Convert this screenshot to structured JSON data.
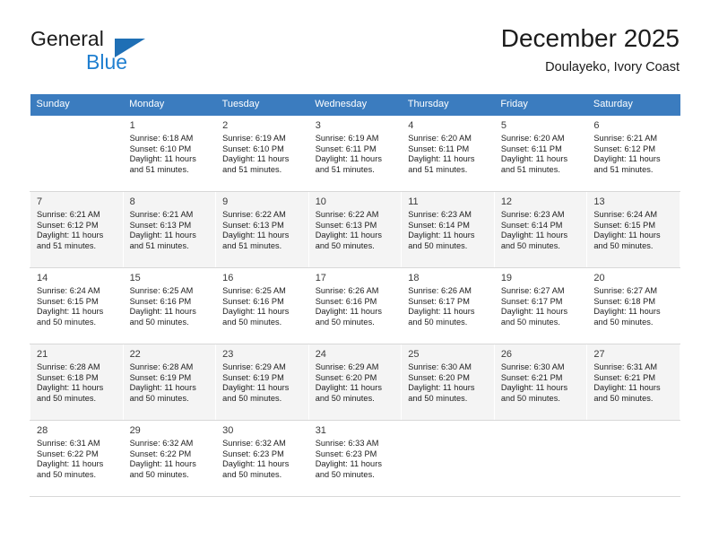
{
  "brand": {
    "name_top": "General",
    "name_bottom": "Blue",
    "triangle_color": "#1f6fb5",
    "blue_color": "#1f7fd0"
  },
  "header": {
    "title": "December 2025",
    "subtitle": "Doulayeko, Ivory Coast"
  },
  "theme": {
    "header_row_bg": "#3b7cbf",
    "header_row_text": "#ffffff",
    "alt_row_bg": "#f4f4f4",
    "cell_border": "#d8d8d8"
  },
  "weekdays": [
    "Sunday",
    "Monday",
    "Tuesday",
    "Wednesday",
    "Thursday",
    "Friday",
    "Saturday"
  ],
  "weeks": [
    {
      "shaded": false,
      "days": [
        {
          "empty": true
        },
        {
          "day": "1",
          "sunrise": "Sunrise: 6:18 AM",
          "sunset": "Sunset: 6:10 PM",
          "daylight_1": "Daylight: 11 hours",
          "daylight_2": "and 51 minutes."
        },
        {
          "day": "2",
          "sunrise": "Sunrise: 6:19 AM",
          "sunset": "Sunset: 6:10 PM",
          "daylight_1": "Daylight: 11 hours",
          "daylight_2": "and 51 minutes."
        },
        {
          "day": "3",
          "sunrise": "Sunrise: 6:19 AM",
          "sunset": "Sunset: 6:11 PM",
          "daylight_1": "Daylight: 11 hours",
          "daylight_2": "and 51 minutes."
        },
        {
          "day": "4",
          "sunrise": "Sunrise: 6:20 AM",
          "sunset": "Sunset: 6:11 PM",
          "daylight_1": "Daylight: 11 hours",
          "daylight_2": "and 51 minutes."
        },
        {
          "day": "5",
          "sunrise": "Sunrise: 6:20 AM",
          "sunset": "Sunset: 6:11 PM",
          "daylight_1": "Daylight: 11 hours",
          "daylight_2": "and 51 minutes."
        },
        {
          "day": "6",
          "sunrise": "Sunrise: 6:21 AM",
          "sunset": "Sunset: 6:12 PM",
          "daylight_1": "Daylight: 11 hours",
          "daylight_2": "and 51 minutes."
        }
      ]
    },
    {
      "shaded": true,
      "days": [
        {
          "day": "7",
          "sunrise": "Sunrise: 6:21 AM",
          "sunset": "Sunset: 6:12 PM",
          "daylight_1": "Daylight: 11 hours",
          "daylight_2": "and 51 minutes."
        },
        {
          "day": "8",
          "sunrise": "Sunrise: 6:21 AM",
          "sunset": "Sunset: 6:13 PM",
          "daylight_1": "Daylight: 11 hours",
          "daylight_2": "and 51 minutes."
        },
        {
          "day": "9",
          "sunrise": "Sunrise: 6:22 AM",
          "sunset": "Sunset: 6:13 PM",
          "daylight_1": "Daylight: 11 hours",
          "daylight_2": "and 51 minutes."
        },
        {
          "day": "10",
          "sunrise": "Sunrise: 6:22 AM",
          "sunset": "Sunset: 6:13 PM",
          "daylight_1": "Daylight: 11 hours",
          "daylight_2": "and 50 minutes."
        },
        {
          "day": "11",
          "sunrise": "Sunrise: 6:23 AM",
          "sunset": "Sunset: 6:14 PM",
          "daylight_1": "Daylight: 11 hours",
          "daylight_2": "and 50 minutes."
        },
        {
          "day": "12",
          "sunrise": "Sunrise: 6:23 AM",
          "sunset": "Sunset: 6:14 PM",
          "daylight_1": "Daylight: 11 hours",
          "daylight_2": "and 50 minutes."
        },
        {
          "day": "13",
          "sunrise": "Sunrise: 6:24 AM",
          "sunset": "Sunset: 6:15 PM",
          "daylight_1": "Daylight: 11 hours",
          "daylight_2": "and 50 minutes."
        }
      ]
    },
    {
      "shaded": false,
      "days": [
        {
          "day": "14",
          "sunrise": "Sunrise: 6:24 AM",
          "sunset": "Sunset: 6:15 PM",
          "daylight_1": "Daylight: 11 hours",
          "daylight_2": "and 50 minutes."
        },
        {
          "day": "15",
          "sunrise": "Sunrise: 6:25 AM",
          "sunset": "Sunset: 6:16 PM",
          "daylight_1": "Daylight: 11 hours",
          "daylight_2": "and 50 minutes."
        },
        {
          "day": "16",
          "sunrise": "Sunrise: 6:25 AM",
          "sunset": "Sunset: 6:16 PM",
          "daylight_1": "Daylight: 11 hours",
          "daylight_2": "and 50 minutes."
        },
        {
          "day": "17",
          "sunrise": "Sunrise: 6:26 AM",
          "sunset": "Sunset: 6:16 PM",
          "daylight_1": "Daylight: 11 hours",
          "daylight_2": "and 50 minutes."
        },
        {
          "day": "18",
          "sunrise": "Sunrise: 6:26 AM",
          "sunset": "Sunset: 6:17 PM",
          "daylight_1": "Daylight: 11 hours",
          "daylight_2": "and 50 minutes."
        },
        {
          "day": "19",
          "sunrise": "Sunrise: 6:27 AM",
          "sunset": "Sunset: 6:17 PM",
          "daylight_1": "Daylight: 11 hours",
          "daylight_2": "and 50 minutes."
        },
        {
          "day": "20",
          "sunrise": "Sunrise: 6:27 AM",
          "sunset": "Sunset: 6:18 PM",
          "daylight_1": "Daylight: 11 hours",
          "daylight_2": "and 50 minutes."
        }
      ]
    },
    {
      "shaded": true,
      "days": [
        {
          "day": "21",
          "sunrise": "Sunrise: 6:28 AM",
          "sunset": "Sunset: 6:18 PM",
          "daylight_1": "Daylight: 11 hours",
          "daylight_2": "and 50 minutes."
        },
        {
          "day": "22",
          "sunrise": "Sunrise: 6:28 AM",
          "sunset": "Sunset: 6:19 PM",
          "daylight_1": "Daylight: 11 hours",
          "daylight_2": "and 50 minutes."
        },
        {
          "day": "23",
          "sunrise": "Sunrise: 6:29 AM",
          "sunset": "Sunset: 6:19 PM",
          "daylight_1": "Daylight: 11 hours",
          "daylight_2": "and 50 minutes."
        },
        {
          "day": "24",
          "sunrise": "Sunrise: 6:29 AM",
          "sunset": "Sunset: 6:20 PM",
          "daylight_1": "Daylight: 11 hours",
          "daylight_2": "and 50 minutes."
        },
        {
          "day": "25",
          "sunrise": "Sunrise: 6:30 AM",
          "sunset": "Sunset: 6:20 PM",
          "daylight_1": "Daylight: 11 hours",
          "daylight_2": "and 50 minutes."
        },
        {
          "day": "26",
          "sunrise": "Sunrise: 6:30 AM",
          "sunset": "Sunset: 6:21 PM",
          "daylight_1": "Daylight: 11 hours",
          "daylight_2": "and 50 minutes."
        },
        {
          "day": "27",
          "sunrise": "Sunrise: 6:31 AM",
          "sunset": "Sunset: 6:21 PM",
          "daylight_1": "Daylight: 11 hours",
          "daylight_2": "and 50 minutes."
        }
      ]
    },
    {
      "shaded": false,
      "days": [
        {
          "day": "28",
          "sunrise": "Sunrise: 6:31 AM",
          "sunset": "Sunset: 6:22 PM",
          "daylight_1": "Daylight: 11 hours",
          "daylight_2": "and 50 minutes."
        },
        {
          "day": "29",
          "sunrise": "Sunrise: 6:32 AM",
          "sunset": "Sunset: 6:22 PM",
          "daylight_1": "Daylight: 11 hours",
          "daylight_2": "and 50 minutes."
        },
        {
          "day": "30",
          "sunrise": "Sunrise: 6:32 AM",
          "sunset": "Sunset: 6:23 PM",
          "daylight_1": "Daylight: 11 hours",
          "daylight_2": "and 50 minutes."
        },
        {
          "day": "31",
          "sunrise": "Sunrise: 6:33 AM",
          "sunset": "Sunset: 6:23 PM",
          "daylight_1": "Daylight: 11 hours",
          "daylight_2": "and 50 minutes."
        },
        {
          "empty": true
        },
        {
          "empty": true
        },
        {
          "empty": true
        }
      ]
    }
  ]
}
